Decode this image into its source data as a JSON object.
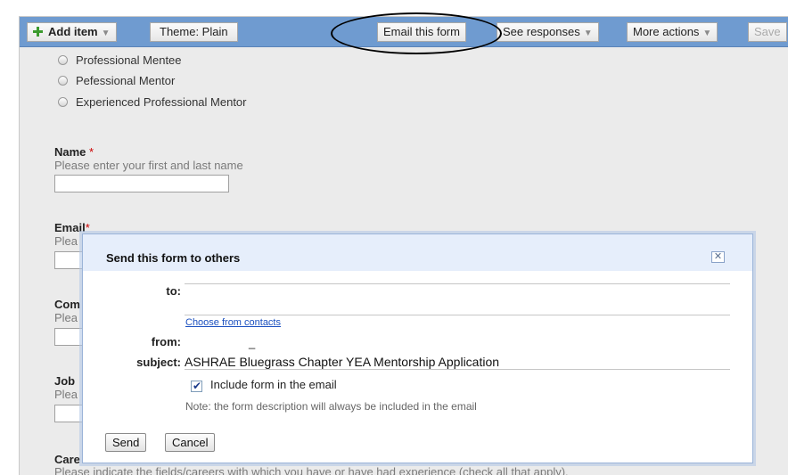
{
  "toolbar": {
    "add_item": "Add item",
    "theme": "Theme:  Plain",
    "email_form": "Email this form",
    "see_responses": "See responses",
    "more_actions": "More actions",
    "save": "Save"
  },
  "form": {
    "options": [
      "Professional Mentee",
      "Pefessional Mentor",
      "Experienced Professional Mentor"
    ],
    "name": {
      "title": "Name",
      "help": "Please enter your first and last name"
    },
    "email": {
      "title": "Email",
      "help": "Plea"
    },
    "company": {
      "title": "Com",
      "help": "Plea"
    },
    "job": {
      "title": "Job",
      "help": "Plea"
    },
    "careers": {
      "title": "Care",
      "help": "Please indicate the fields/careers with which you have or have had experience (check all that apply)."
    },
    "required_mark": "*"
  },
  "dialog": {
    "title": "Send this form to others",
    "close_glyph": "✕",
    "to_label": "to:",
    "choose_contacts": "Choose from contacts",
    "from_label": "from:",
    "from_value": "_",
    "subject_label": "subject:",
    "subject_value": "ASHRAE Bluegrass Chapter YEA Mentorship Application",
    "include_label": "Include form in the email",
    "include_checked": true,
    "note": "Note: the form description will always be included in the email",
    "send": "Send",
    "cancel": "Cancel"
  },
  "colors": {
    "toolbar": "#6f9bd0",
    "dialog_header": "#e6eefb",
    "link": "#1a4fbf"
  }
}
